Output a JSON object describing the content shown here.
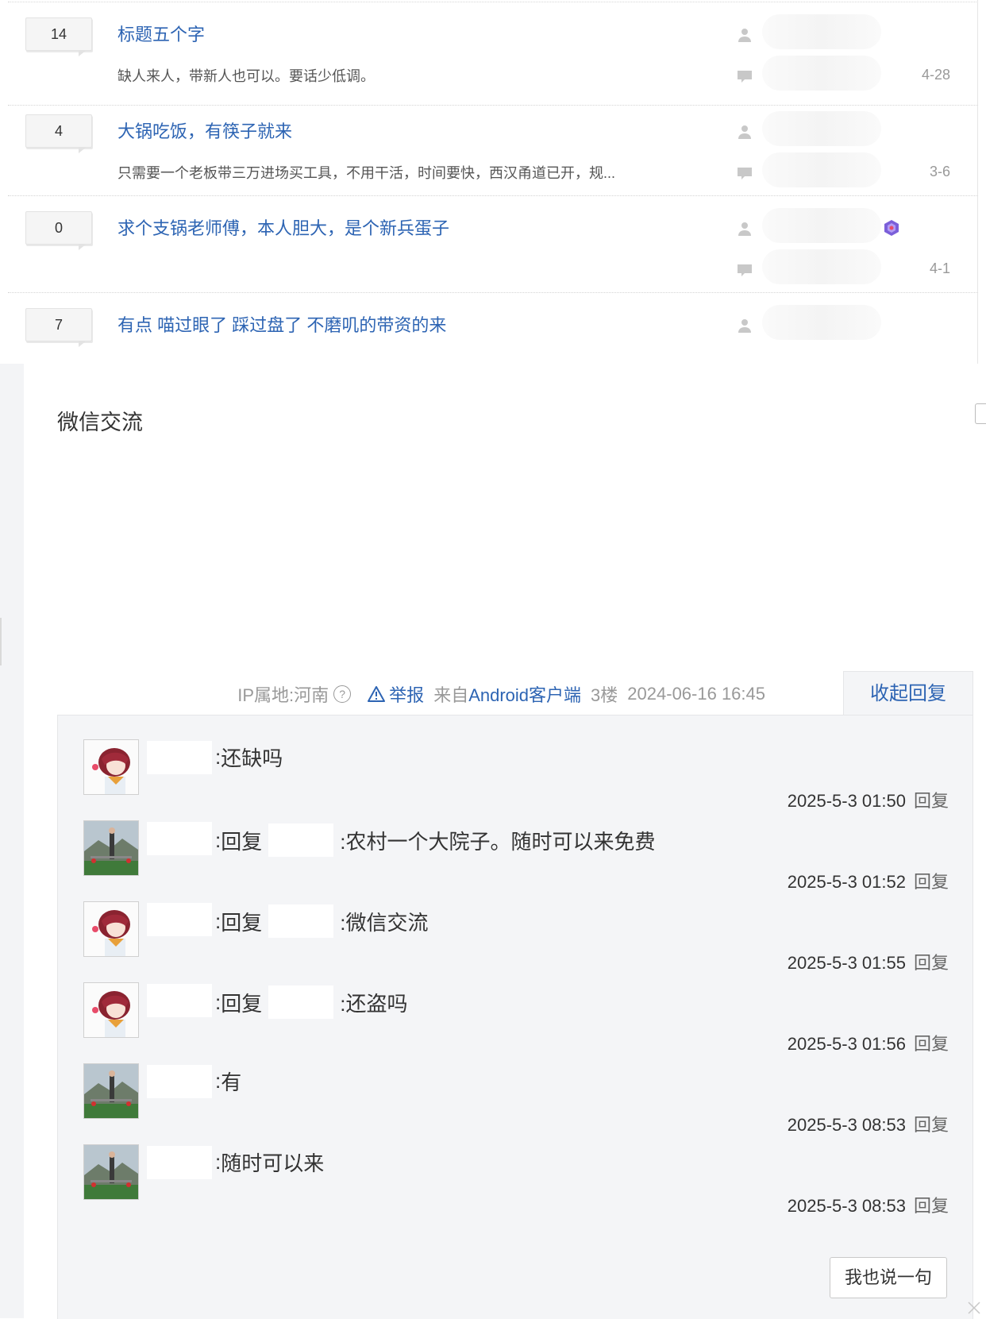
{
  "threads": [
    {
      "reply_count": "14",
      "title": "标题五个字",
      "abstract": "缺人来人，带新人也可以。要话少低调。",
      "date": "4-28"
    },
    {
      "reply_count": "4",
      "title": "大锅吃饭，有筷子就来",
      "abstract": "只需要一个老板带三万进场买工具，不用干活，时间要快，西汉甬道已开，规...",
      "date": "3-6"
    },
    {
      "reply_count": "0",
      "title": "求个支锅老师傅，本人胆大，是个新兵蛋子",
      "abstract": "",
      "date": "4-1"
    },
    {
      "reply_count": "7",
      "title": "有点 喵过眼了 踩过盘了 不磨叽的带资的来",
      "abstract": "",
      "date": ""
    }
  ],
  "post": {
    "content": "微信交流",
    "ip_location": "IP属地:河南",
    "help": "?",
    "report": "举报",
    "from_prefix": "来自",
    "client": "Android客户端",
    "floor": "3楼",
    "time": "2024-06-16 16:45",
    "collapse_label": "收起回复"
  },
  "lzl": {
    "colon": ":",
    "reply_word": "回复",
    "reply_action": "回复",
    "say_button": "我也说一句",
    "items": [
      {
        "avatar": "anime-avatar",
        "is_reply": false,
        "text": "还缺吗",
        "time": "2025-5-3 01:50"
      },
      {
        "avatar": "mountain-avatar",
        "is_reply": true,
        "text": ":农村一个大院子。随时可以来免费",
        "time": "2025-5-3 01:52"
      },
      {
        "avatar": "anime-avatar",
        "is_reply": true,
        "text": ":微信交流",
        "time": "2025-5-3 01:55"
      },
      {
        "avatar": "anime-avatar",
        "is_reply": true,
        "text": ":还盗吗",
        "time": "2025-5-3 01:56"
      },
      {
        "avatar": "mountain-avatar",
        "is_reply": false,
        "text": "有",
        "time": "2025-5-3 08:53"
      },
      {
        "avatar": "mountain-avatar",
        "is_reply": false,
        "text": "随时可以来",
        "time": "2025-5-3 08:53"
      }
    ]
  },
  "colors": {
    "link": "#2d64b3",
    "panel_bg": "#f4f5f7",
    "muted": "#999999"
  }
}
